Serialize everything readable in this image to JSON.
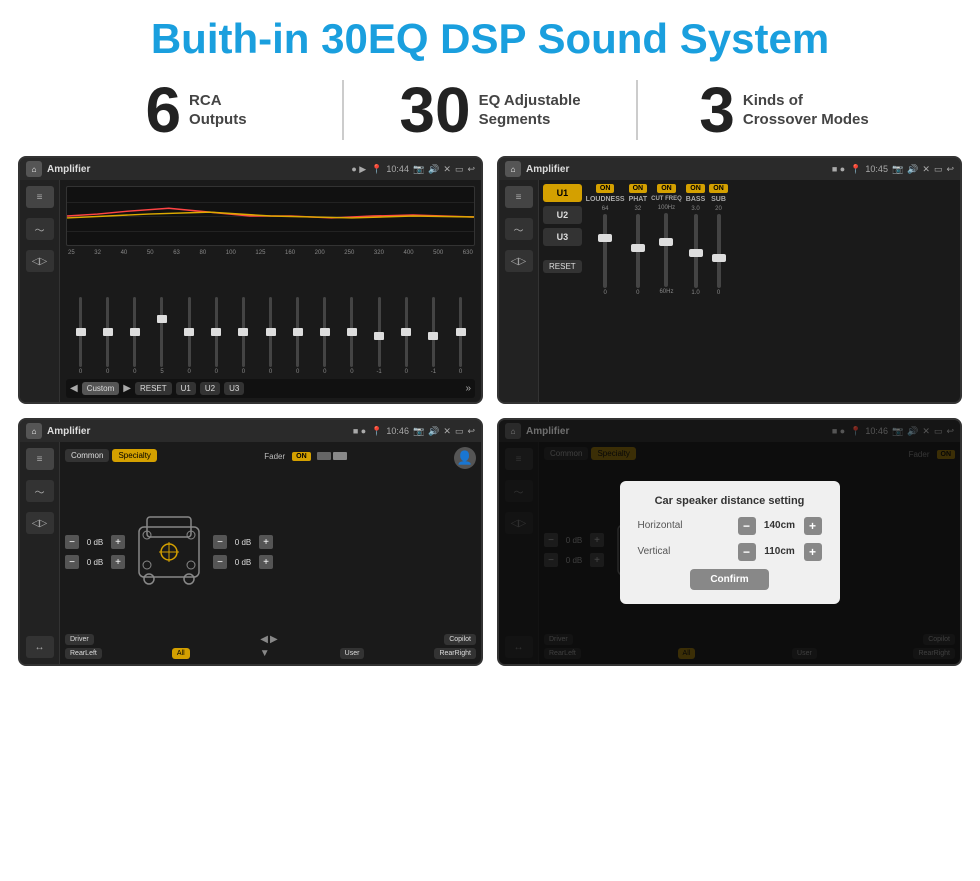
{
  "header": {
    "title": "Buith-in 30EQ DSP Sound System"
  },
  "stats": [
    {
      "number": "6",
      "label": "RCA\nOutputs"
    },
    {
      "number": "30",
      "label": "EQ Adjustable\nSegments"
    },
    {
      "number": "3",
      "label": "Kinds of\nCrossover Modes"
    }
  ],
  "screens": [
    {
      "id": "eq-screen",
      "title": "Amplifier",
      "time": "10:44",
      "type": "eq"
    },
    {
      "id": "crossover-screen",
      "title": "Amplifier",
      "time": "10:45",
      "type": "crossover"
    },
    {
      "id": "speaker-screen",
      "title": "Amplifier",
      "time": "10:46",
      "type": "speaker"
    },
    {
      "id": "distance-screen",
      "title": "Amplifier",
      "time": "10:46",
      "type": "distance"
    }
  ],
  "eq": {
    "frequencies": [
      "25",
      "32",
      "40",
      "50",
      "63",
      "80",
      "100",
      "125",
      "160",
      "200",
      "250",
      "320",
      "400",
      "500",
      "630"
    ],
    "values": [
      "0",
      "0",
      "0",
      "5",
      "0",
      "0",
      "0",
      "0",
      "0",
      "0",
      "0",
      "-1",
      "0",
      "-1"
    ],
    "preset": "Custom",
    "buttons": [
      "RESET",
      "U1",
      "U2",
      "U3"
    ]
  },
  "crossover": {
    "units": [
      "U1",
      "U2",
      "U3"
    ],
    "channels": [
      "LOUDNESS",
      "PHAT",
      "CUT FREQ",
      "BASS",
      "SUB"
    ],
    "reset_label": "RESET"
  },
  "speaker": {
    "tabs": [
      "Common",
      "Specialty"
    ],
    "active_tab": "Specialty",
    "fader_label": "Fader",
    "fader_on": "ON",
    "controls": [
      {
        "label": "0 dB"
      },
      {
        "label": "0 dB"
      },
      {
        "label": "0 dB"
      },
      {
        "label": "0 dB"
      }
    ],
    "bottom_buttons": [
      "Driver",
      "",
      "",
      "",
      "Copilot",
      "RearLeft",
      "All",
      "",
      "User",
      "RearRight"
    ]
  },
  "distance_dialog": {
    "title": "Car speaker distance setting",
    "horizontal_label": "Horizontal",
    "horizontal_value": "140cm",
    "vertical_label": "Vertical",
    "vertical_value": "110cm",
    "confirm_label": "Confirm"
  }
}
